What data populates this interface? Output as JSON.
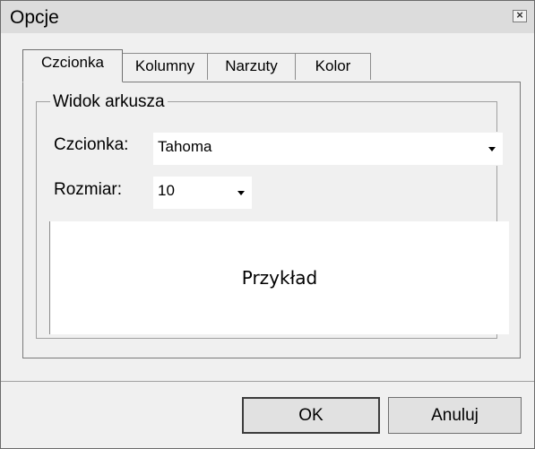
{
  "window": {
    "title": "Opcje",
    "close_glyph": "×"
  },
  "tabs": [
    {
      "label": "Czcionka",
      "active": true
    },
    {
      "label": "Kolumny",
      "active": false
    },
    {
      "label": "Narzuty",
      "active": false
    },
    {
      "label": "Kolor",
      "active": false
    }
  ],
  "group": {
    "label": "Widok arkusza",
    "font": {
      "label": "Czcionka:",
      "value": "Tahoma"
    },
    "size": {
      "label": "Rozmiar:",
      "value": "10"
    },
    "preview_text": "Przykład"
  },
  "buttons": {
    "ok": "OK",
    "cancel": "Anuluj"
  }
}
